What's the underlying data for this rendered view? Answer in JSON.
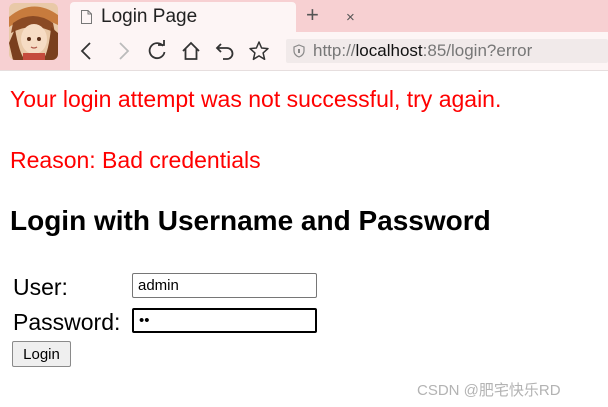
{
  "browser": {
    "tab_title": "Login Page",
    "tab_close": "×",
    "new_tab": "+",
    "address": {
      "scheme": "http://",
      "host": "localhost",
      "rest": ":85/login?error"
    }
  },
  "page": {
    "error_message": "Your login attempt was not successful, try again.",
    "error_reason": "Reason: Bad credentials",
    "heading": "Login with Username and Password",
    "form": {
      "user_label": "User:",
      "user_value": "admin",
      "password_label": "Password:",
      "password_value": "ab",
      "submit_label": "Login"
    }
  },
  "watermark": "CSDN @肥宅快乐RD",
  "colors": {
    "chrome": "#f7d0d2",
    "tab": "#fdf5f5",
    "error": "#ff0000"
  }
}
